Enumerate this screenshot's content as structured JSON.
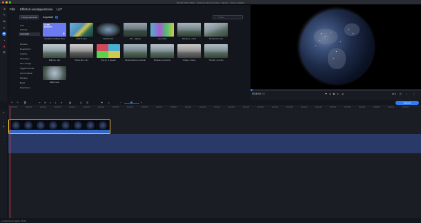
{
  "window": {
    "title": "Movavi Video Editor – Sessione di prova (video 7 giorni) – Nuovo progetto"
  },
  "left_tools": [
    {
      "icon": "import-icon"
    },
    {
      "icon": "filters-icon"
    },
    {
      "icon": "transitions-icon"
    },
    {
      "icon": "titles-icon"
    },
    {
      "icon": "effects-icon",
      "active": true
    },
    {
      "icon": "stickers-icon"
    },
    {
      "icon": "record-icon"
    },
    {
      "icon": "more-tools-icon"
    }
  ],
  "tabs": [
    "Filtri",
    "Effetti di sovrapposizione",
    "LUT"
  ],
  "categories": {
    "dropdown": "Tutti gli elementi",
    "items": [
      "Tutti",
      "Preferiti",
      "Acquistati",
      "Rumore",
      "Regolazioni",
      "Artistico",
      "Sfumature",
      "Film vintage",
      "Oggetti animati",
      "Luci di scena",
      "Mosaico",
      "Bordi",
      "Ripetizione"
    ],
    "selected_index": 2
  },
  "effects": {
    "title": "Acquistati",
    "search_placeholder": "Trova",
    "items": [
      {
        "label": "Visualizza in Effects Store",
        "tag": "ALTRI EFFETTI",
        "featured": true
      },
      {
        "label": "Artist di carta"
      },
      {
        "label": "Bordi fumosi"
      },
      {
        "label": "Film - rigatura"
      },
      {
        "label": "Luce calda"
      },
      {
        "label": "Sfocatura - colore"
      },
      {
        "label": "Sfocatura di moto"
      },
      {
        "label": "Bellezza - alto"
      },
      {
        "label": "Picture alto - film"
      },
      {
        "label": "Pop art - 4 riquadri"
      },
      {
        "label": "Rimpicciolimento verticale"
      },
      {
        "label": "Sfocatura movimento"
      },
      {
        "label": "Vintage - bianco"
      },
      {
        "label": "Tilt-shift - al centro"
      },
      {
        "label": "Effetto lente"
      }
    ]
  },
  "playback": {
    "timecode": "00:00:00",
    "timecode_ms": ".000",
    "aspect": "16:9",
    "progress_percent": 0
  },
  "timeline": {
    "export_label": "Esporta",
    "ruler": [
      "00:00:00",
      "00:00:05",
      "00:00:10",
      "00:00:15",
      "00:00:20",
      "00:00:25",
      "00:00:30",
      "00:00:35",
      "00:00:40",
      "00:00:45",
      "00:00:50",
      "00:00:55",
      "00:01:00",
      "00:01:05",
      "00:01:10",
      "00:01:15",
      "00:01:20",
      "00:01:25",
      "00:01:30",
      "00:01:35",
      "00:01:40",
      "00:01:45",
      "00:01:50",
      "00:01:55",
      "00:02:00",
      "00:02:05",
      "00:02:10",
      "00:02:15"
    ],
    "clip_frames": 8
  },
  "status": {
    "text": "Lunghezza progetto: 00:24"
  },
  "colors": {
    "accent": "#2f7cf6",
    "clip_border": "#e3b63a",
    "playhead": "#e0444f"
  }
}
